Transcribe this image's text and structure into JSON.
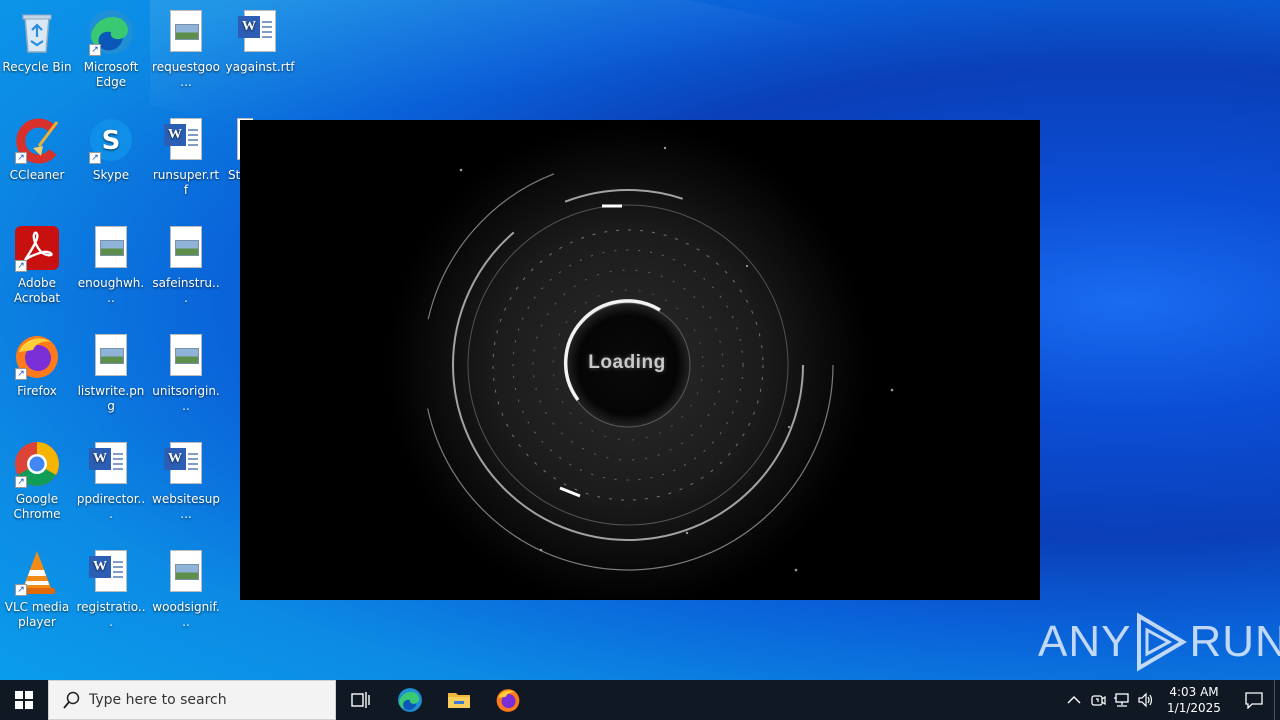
{
  "desktop_icons": [
    {
      "label": "Recycle Bin",
      "icon": "recycle-bin-icon"
    },
    {
      "label": "Microsoft Edge",
      "icon": "edge-icon"
    },
    {
      "label": "requestgoo...",
      "icon": "image-file-icon"
    },
    {
      "label": "yagainst.rtf",
      "icon": "word-document-icon"
    },
    {
      "label": "CCleaner",
      "icon": "ccleaner-icon"
    },
    {
      "label": "Skype",
      "icon": "skype-icon"
    },
    {
      "label": "runsuper.rtf",
      "icon": "word-document-icon"
    },
    {
      "label": "Str",
      "icon": "document-icon"
    },
    {
      "label": "Adobe Acrobat",
      "icon": "acrobat-icon"
    },
    {
      "label": "enoughwh...",
      "icon": "image-file-icon"
    },
    {
      "label": "safeinstru...",
      "icon": "image-file-icon"
    },
    {
      "label": "Firefox",
      "icon": "firefox-icon"
    },
    {
      "label": "listwrite.png",
      "icon": "image-file-icon"
    },
    {
      "label": "unitsorigin...",
      "icon": "image-file-icon"
    },
    {
      "label": "Google Chrome",
      "icon": "chrome-icon"
    },
    {
      "label": "ppdirector...",
      "icon": "word-document-icon"
    },
    {
      "label": "websitesup...",
      "icon": "word-document-icon"
    },
    {
      "label": "VLC media player",
      "icon": "vlc-icon"
    },
    {
      "label": "registratio...",
      "icon": "word-document-icon"
    },
    {
      "label": "woodsignif...",
      "icon": "image-file-icon"
    }
  ],
  "loader": {
    "text": "Loading"
  },
  "watermark": {
    "left": "ANY",
    "right": "RUN"
  },
  "taskbar": {
    "search_placeholder": "Type here to search",
    "pinned": [
      "task-view-icon",
      "edge-icon",
      "file-explorer-icon",
      "firefox-icon"
    ],
    "time": "4:03 AM",
    "date": "1/1/2025"
  },
  "colors": {
    "taskbar": "#101923",
    "desktop_accent": "#0b4fd6"
  }
}
